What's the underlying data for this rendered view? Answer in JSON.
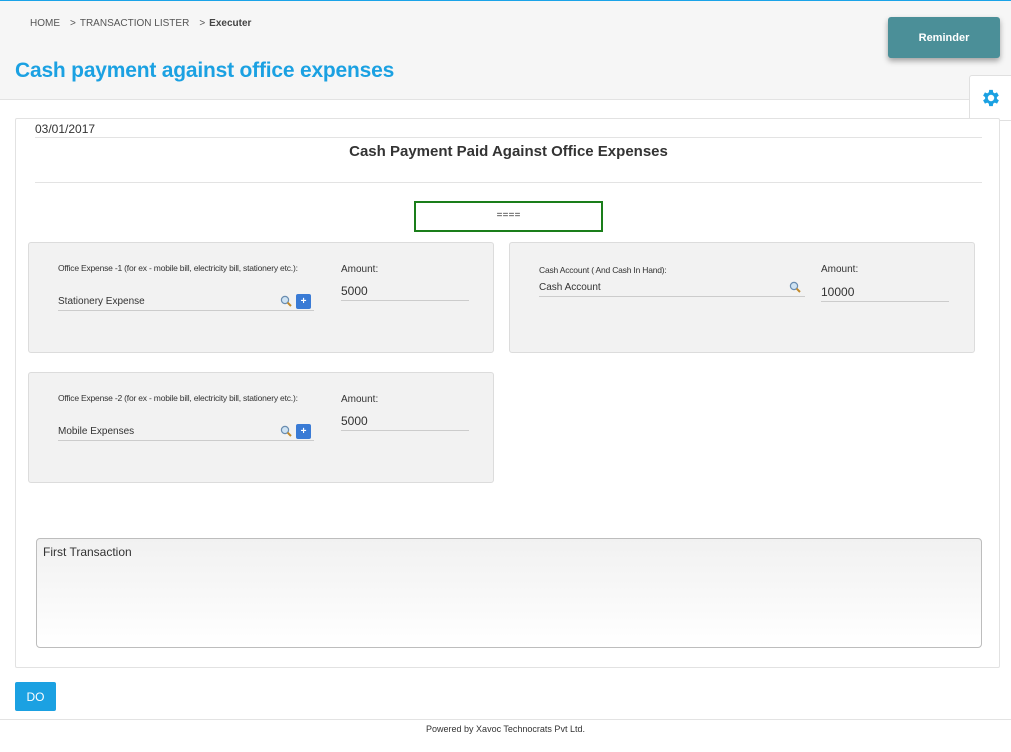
{
  "breadcrumb": {
    "home": "HOME",
    "sep1": ">",
    "lister": "TRANSACTION LISTER",
    "sep2": ">",
    "current": "Executer"
  },
  "page_title": "Cash payment against office expenses",
  "reminder_label": "Reminder",
  "form": {
    "date": "03/01/2017",
    "title": "Cash Payment Paid Against Office Expenses",
    "doc_no": "===="
  },
  "expense1": {
    "label": "Office Expense -1 (for ex - mobile bill, electricity bill, stationery etc.):",
    "value": "Stationery Expense",
    "amount_label": "Amount:",
    "amount": "5000"
  },
  "cash_account": {
    "label": "Cash Account ( And Cash In Hand):",
    "value": "Cash Account",
    "amount_label": "Amount:",
    "amount": "10000"
  },
  "expense2": {
    "label": "Office Expense -2 (for ex - mobile bill, electricity bill, stationery etc.):",
    "value": "Mobile Expenses",
    "amount_label": "Amount:",
    "amount": "5000"
  },
  "narration": "First Transaction",
  "plus_label": "+",
  "do_label": "DO",
  "footer": "Powered by Xavoc Technocrats Pvt Ltd.",
  "colors": {
    "accent": "#1ba1e2",
    "reminder": "#4b8f98",
    "doc_border": "#1a7e1a",
    "plus": "#3a7bd5"
  }
}
